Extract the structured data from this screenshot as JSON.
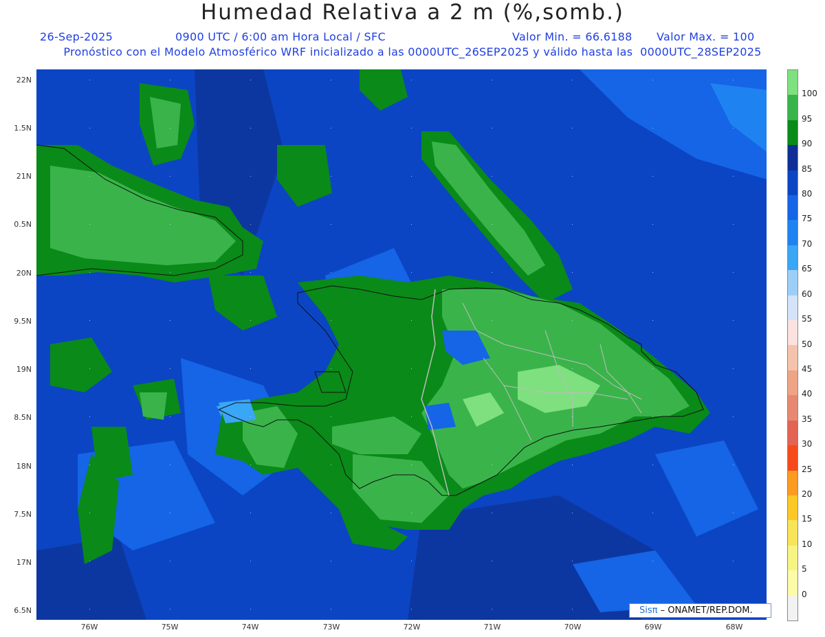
{
  "header": {
    "title": "Humedad Relativa a 2 m (%,somb.)",
    "date": "26-Sep-2025",
    "time_info": "0900 UTC / 6:00 am Hora Local / SFC",
    "min_value": "Valor Min. = 66.6188",
    "max_value": "Valor Max. = 100",
    "run_info": "Pronóstico con el Modelo Atmosférico WRF inicializado a las 0000UTC_26SEP2025 y válido hasta las  0000UTC_28SEP2025"
  },
  "axes": {
    "lat_labels": [
      "22N",
      "1.5N",
      "21N",
      "0.5N",
      "20N",
      "9.5N",
      "19N",
      "8.5N",
      "18N",
      "7.5N",
      "17N",
      "6.5N"
    ],
    "lon_labels": [
      "76W",
      "75W",
      "74W",
      "73W",
      "72W",
      "71W",
      "70W",
      "69W",
      "68W"
    ]
  },
  "legend": {
    "labels": [
      "100",
      "95",
      "90",
      "85",
      "80",
      "75",
      "70",
      "65",
      "60",
      "55",
      "50",
      "45",
      "40",
      "35",
      "30",
      "25",
      "20",
      "15",
      "10",
      "5",
      "0"
    ],
    "colors": [
      "#7ee07e",
      "#3ab44a",
      "#0a8a18",
      "#102e96",
      "#0b45c4",
      "#1565e6",
      "#1e83f0",
      "#3aa6f6",
      "#9ccff8",
      "#d4e3fb",
      "#fbe2e0",
      "#f5c3ac",
      "#eda586",
      "#e68872",
      "#e46454",
      "#f64a1c",
      "#fb9b20",
      "#fcc828",
      "#f8e458",
      "#f8f484",
      "#fbfba8",
      "#f2f2f2"
    ]
  },
  "credit": {
    "logo": "Sisπ",
    "text": "– ONAMET/REP.DOM."
  },
  "colors": {
    "ocean_deep": "#0d3aa8",
    "ocean": "#0b45c4",
    "humid_high": "#3ab44a",
    "humid_mid": "#0a8a18",
    "humid_max": "#7ee07e"
  }
}
